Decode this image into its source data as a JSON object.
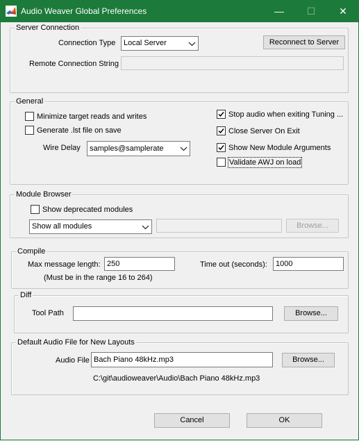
{
  "window": {
    "title": "Audio Weaver Global Preferences",
    "minimize_glyph": "—",
    "maximize_glyph": "☐",
    "close_glyph": "✕"
  },
  "server": {
    "legend": "Server Connection",
    "connection_type_label": "Connection Type",
    "connection_type_value": "Local Server",
    "reconnect_label": "Reconnect to Server",
    "remote_label": "Remote Connection String",
    "remote_value": ""
  },
  "general": {
    "legend": "General",
    "minimize_reads_label": "Minimize target reads and writes",
    "minimize_reads_checked": false,
    "generate_lst_label": "Generate .lst file on save",
    "generate_lst_checked": false,
    "wire_delay_label": "Wire Delay",
    "wire_delay_value": "samples@samplerate",
    "stop_audio_label": "Stop audio when exiting Tuning ...",
    "stop_audio_checked": true,
    "close_server_label": "Close Server On Exit",
    "close_server_checked": true,
    "show_args_label": "Show New Module Arguments",
    "show_args_checked": true,
    "validate_awj_label": "Validate AWJ on load",
    "validate_awj_checked": false
  },
  "module_browser": {
    "legend": "Module Browser",
    "show_deprecated_label": "Show deprecated modules",
    "show_deprecated_checked": false,
    "filter_value": "Show all modules",
    "path_value": "",
    "browse_label": "Browse..."
  },
  "compile": {
    "legend": "Compile",
    "max_msg_label": "Max message length:",
    "max_msg_value": "250",
    "range_note": "(Must be in the range 16 to 264)",
    "timeout_label": "Time out (seconds):",
    "timeout_value": "1000"
  },
  "diff": {
    "legend": "Diff",
    "tool_path_label": "Tool Path",
    "tool_path_value": "",
    "browse_label": "Browse..."
  },
  "default_audio": {
    "legend": "Default Audio File for New Layouts",
    "audio_file_label": "Audio File",
    "audio_file_value": "Bach Piano 48kHz.mp3",
    "browse_label": "Browse...",
    "full_path": "C:\\git\\audioweaver\\Audio\\Bach Piano 48kHz.mp3"
  },
  "footer": {
    "cancel_label": "Cancel",
    "ok_label": "OK"
  }
}
